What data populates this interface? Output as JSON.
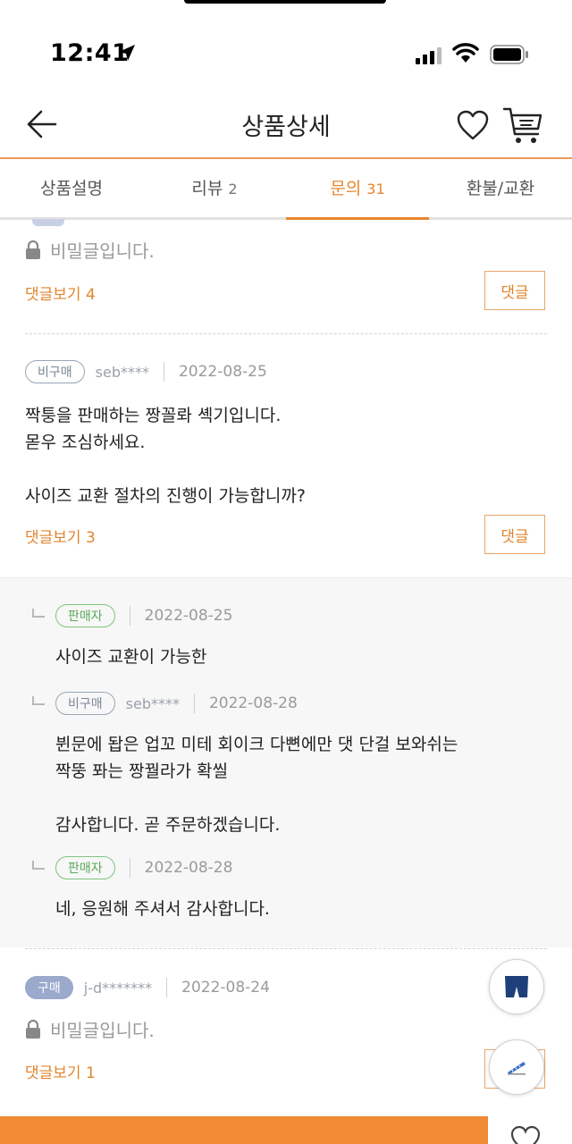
{
  "status": {
    "time": "12:41",
    "icons": [
      "location-arrow-icon",
      "signal-icon",
      "wifi-icon",
      "battery-icon"
    ]
  },
  "header": {
    "title": "상품상세",
    "icons": [
      "back-arrow-icon",
      "heart-icon",
      "cart-icon"
    ]
  },
  "tabs": [
    {
      "label": "상품설명",
      "count": ""
    },
    {
      "label": "리뷰",
      "count": "2"
    },
    {
      "label": "문의",
      "count": "31",
      "active": true
    },
    {
      "label": "환불/교환",
      "count": ""
    }
  ],
  "first_item": {
    "secret_text": "비밀글입니다.",
    "replies_label": "댓글보기 4",
    "reply_button": "댓글"
  },
  "second_item": {
    "badge": "비구매",
    "user": "seb****",
    "date": "2022-08-25",
    "body": "짝퉁을 판매하는 짱꼴롸 셱기입니다.\n몯우 조심하세요.\n\n사이즈 교환 절차의 진행이 가능합니까?",
    "replies_label": "댓글보기 3",
    "reply_button": "댓글"
  },
  "replies": [
    {
      "badge": "판매자",
      "user": "",
      "date": "2022-08-25",
      "text": "사이즈 교환이 가능한"
    },
    {
      "badge": "비구매",
      "user": "seb****",
      "date": "2022-08-28",
      "text": "뷘문에 돱은 업꼬 미테 회이크 다뼌에만 댓 단걸 보와쉬는\n짝뚱 퐈는 짱꿜라가 확씰\n\n감사합니다. 곧 주문하겠습니다."
    },
    {
      "badge": "판매자",
      "user": "",
      "date": "2022-08-28",
      "text": "네, 응원해 주셔서 감사합니다."
    }
  ],
  "third_item": {
    "badge": "구매",
    "user": "j-d*******",
    "date": "2022-08-24",
    "secret_text": "비밀글입니다.",
    "replies_label": "댓글보기 1"
  },
  "colors": {
    "accent": "#e8862e",
    "buy_button": "#f08a34",
    "seller_badge": "#5aa95a"
  }
}
